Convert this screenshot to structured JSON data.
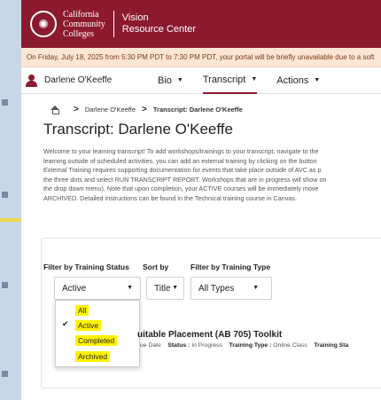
{
  "header": {
    "logo_lines": [
      "California",
      "Community",
      "Colleges"
    ],
    "site_name_lines": [
      "Vision",
      "Resource Center"
    ],
    "accent": "#8c1a2f"
  },
  "notice": {
    "text": "On Friday, July 18, 2025 from 5:30 PM PDT to 7:30 PM PDT, your portal will be briefly unavailable due to a soft",
    "background": "#fbe6d6"
  },
  "nav": {
    "user_name": "Darlene O'Keeffe",
    "items": [
      {
        "label": "Bio"
      },
      {
        "label": "Transcript"
      },
      {
        "label": "Actions"
      }
    ],
    "active_item": "Transcript"
  },
  "breadcrumb": {
    "home_icon": "home-icon",
    "items": [
      "Darlene O'Keeffe",
      "Transcript: Darlene O'Keeffe"
    ]
  },
  "page": {
    "title": "Transcript: Darlene O'Keeffe",
    "intro_lines": [
      "Welcome to your learning transcript! To add workshops/trainings to your transcript, navigate to the",
      "learning outside of scheduled activities, you can add an external training by clicking on the button",
      "External Training requires supporting documentation for events that take place outside of AVC as p",
      "the three dots and select RUN TRANSCRIPT REPORT. Workshops that are in progress will show on",
      "the drop down menu). Note that upon completion, your ACTIVE courses will be immediately move",
      "ARCHIVED. Detailed instructions can be found in the Technical training course in Canvas."
    ]
  },
  "filters": {
    "status_label": "Filter by Training Status",
    "sort_label": "Sort by",
    "type_label": "Filter by Training Type",
    "status_value": "Active",
    "sort_value": "Title",
    "type_value": "All Types",
    "status_options": [
      "All",
      "Active",
      "Completed",
      "Archived"
    ],
    "status_checked": "Active",
    "highlight_color": "#fff200"
  },
  "course": {
    "title_fragment": "uitable Placement (AB 705) Toolkit",
    "meta_due_fragment": "ue Date",
    "status_label": "Status :",
    "status_value": "In Progress",
    "type_label": "Training Type :",
    "type_value": "Online Class",
    "training_status_fragment": "Training Sta"
  }
}
